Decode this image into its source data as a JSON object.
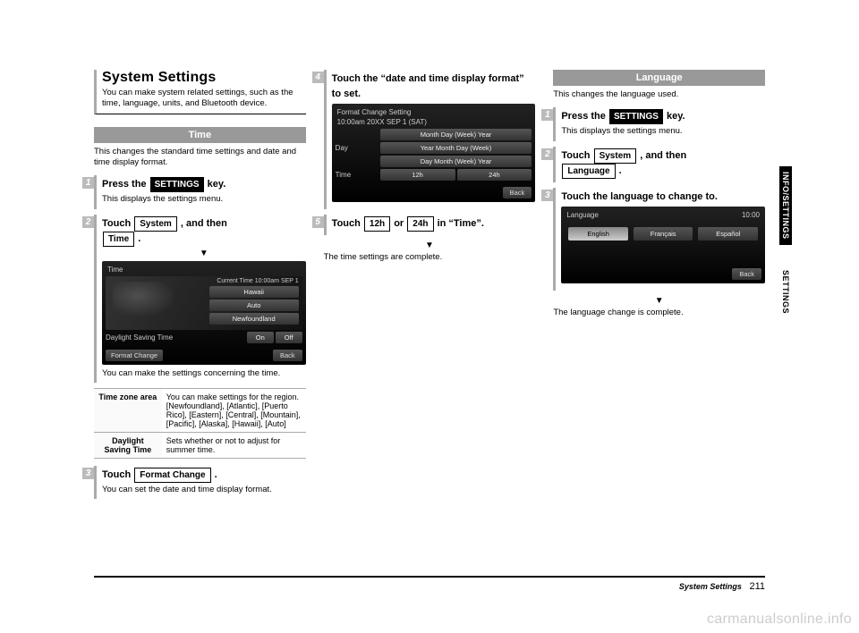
{
  "header": {
    "title": "System Settings",
    "intro": "You can make system related settings, such as the time, language, units, and Bluetooth device."
  },
  "time": {
    "heading": "Time",
    "desc": "This changes the standard time settings and date and time display format.",
    "step1": {
      "num": "1",
      "a": "Press the ",
      "key": "SETTINGS",
      "b": " key.",
      "sub": "This displays the settings menu."
    },
    "step2": {
      "num": "2",
      "a": "Touch ",
      "key1": "System",
      "b": " , and then ",
      "key2": "Time",
      "c": " ."
    },
    "shot1": {
      "title": "Time",
      "curTime": "Current Time 10:00am SEP  1",
      "tz_lines": [
        "Hawaii",
        "Auto",
        "Newfoundland"
      ],
      "dst_label": "Daylight Saving Time",
      "dst_on": "On",
      "dst_off": "Off",
      "format": "Format Change",
      "back": "Back"
    },
    "step2sub": "You can make the settings concerning the time.",
    "table": {
      "r1": {
        "h": "Time zone area",
        "v": "You can make settings for the region.\n[Newfoundland], [Atlantic], [Puerto Rico], [Eastern], [Central], [Mountain], [Pacific], [Alaska], [Hawaii], [Auto]"
      },
      "r2": {
        "h": "Daylight Saving Time",
        "v": "Sets whether or not to adjust for summer time."
      }
    },
    "step3": {
      "num": "3",
      "a": "Touch ",
      "key": "Format Change",
      "b": " .",
      "sub": "You can set the date and time display format."
    }
  },
  "format": {
    "step4": {
      "num": "4",
      "text": "Touch the “date and time display format” to set."
    },
    "shot": {
      "title": "Format Change Setting",
      "sub": "10:00am 20XX SEP  1  (SAT)",
      "day_label": "Day",
      "opts": [
        "Month Day (Week) Year",
        "Year Month Day (Week)",
        "Day Month (Week) Year"
      ],
      "time_label": "Time",
      "t12": "12h",
      "t24": "24h",
      "back": "Back"
    },
    "step5": {
      "num": "5",
      "a": "Touch ",
      "k1": "12h",
      "b": " or ",
      "k2": "24h",
      "c": " in “Time”."
    },
    "done": "The time settings are complete."
  },
  "language": {
    "heading": "Language",
    "desc": "This changes the language used.",
    "step1": {
      "num": "1",
      "a": "Press the ",
      "key": "SETTINGS",
      "b": " key.",
      "sub": "This displays the settings menu."
    },
    "step2": {
      "num": "2",
      "a": "Touch ",
      "key1": "System",
      "b": " , and then ",
      "key2": "Language",
      "c": " ."
    },
    "step3": {
      "num": "3",
      "text": "Touch the language to change to."
    },
    "shot": {
      "title": "Language",
      "clock": "10:00",
      "opts": [
        "English",
        "Français",
        "Español"
      ],
      "back": "Back"
    },
    "done": "The language change is complete."
  },
  "sidetabs": {
    "t1": "INFO/SETTINGS",
    "t2": "SETTINGS"
  },
  "footer": {
    "section": "System Settings",
    "page": "211"
  },
  "watermark": "carmanualsonline.info"
}
